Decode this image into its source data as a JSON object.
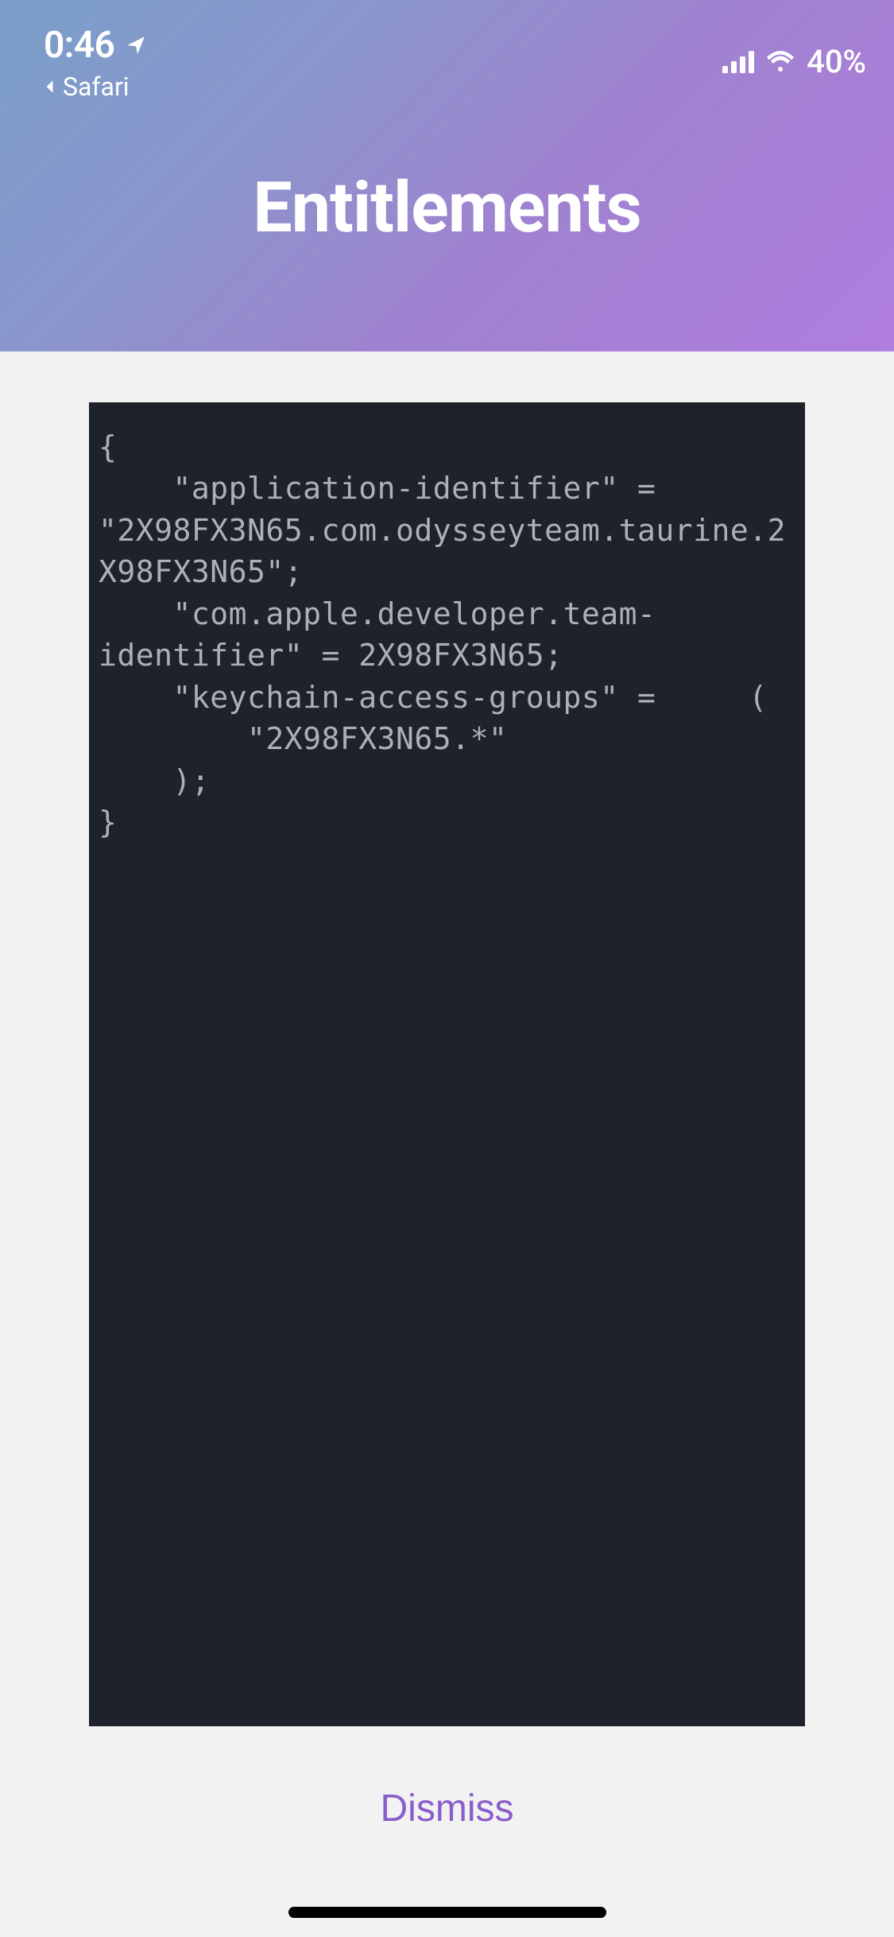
{
  "status_bar": {
    "time": "0:46",
    "back_app": "Safari",
    "battery": "40%"
  },
  "header": {
    "title": "Entitlements"
  },
  "code": {
    "content": "{\n    \"application-identifier\" = \"2X98FX3N65.com.odysseyteam.taurine.2X98FX3N65\";\n    \"com.apple.developer.team-identifier\" = 2X98FX3N65;\n    \"keychain-access-groups\" =     (\n        \"2X98FX3N65.*\"\n    );\n}"
  },
  "actions": {
    "dismiss": "Dismiss"
  }
}
